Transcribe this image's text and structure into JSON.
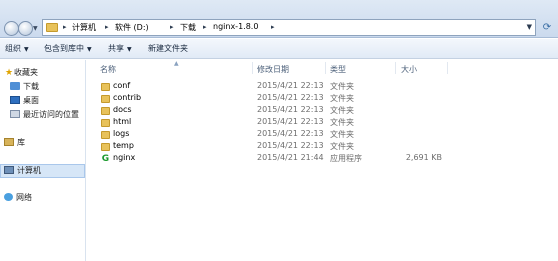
{
  "address": {
    "crumbs": [
      "计算机",
      "软件 (D:)",
      "下载",
      "nginx-1.8.0"
    ],
    "separator": "▸",
    "dropdown_icon": "chevron-down-icon",
    "refresh_icon": "refresh-icon"
  },
  "toolbar": {
    "organize": "组织",
    "include_in_library": "包含到库中",
    "share": "共享",
    "new_folder": "新建文件夹"
  },
  "nav": {
    "favorites": "收藏夹",
    "downloads": "下载",
    "desktop": "桌面",
    "recent": "最近访问的位置",
    "libraries": "库",
    "computer": "计算机",
    "network": "网络"
  },
  "columns": {
    "name": "名称",
    "modified": "修改日期",
    "type": "类型",
    "size": "大小"
  },
  "files": [
    {
      "name": "conf",
      "modified": "2015/4/21 22:13",
      "type": "文件夹",
      "size": "",
      "icon": "folder-icon"
    },
    {
      "name": "contrib",
      "modified": "2015/4/21 22:13",
      "type": "文件夹",
      "size": "",
      "icon": "folder-icon"
    },
    {
      "name": "docs",
      "modified": "2015/4/21 22:13",
      "type": "文件夹",
      "size": "",
      "icon": "folder-icon"
    },
    {
      "name": "html",
      "modified": "2015/4/21 22:13",
      "type": "文件夹",
      "size": "",
      "icon": "folder-icon"
    },
    {
      "name": "logs",
      "modified": "2015/4/21 22:13",
      "type": "文件夹",
      "size": "",
      "icon": "folder-icon"
    },
    {
      "name": "temp",
      "modified": "2015/4/21 22:13",
      "type": "文件夹",
      "size": "",
      "icon": "folder-icon"
    },
    {
      "name": "nginx",
      "modified": "2015/4/21 21:44",
      "type": "应用程序",
      "size": "2,691 KB",
      "icon": "nginx-app-icon"
    }
  ],
  "colors": {
    "accent": "#d6e6f7",
    "folder": "#e8c25a",
    "exe": "#1b9a2e"
  }
}
